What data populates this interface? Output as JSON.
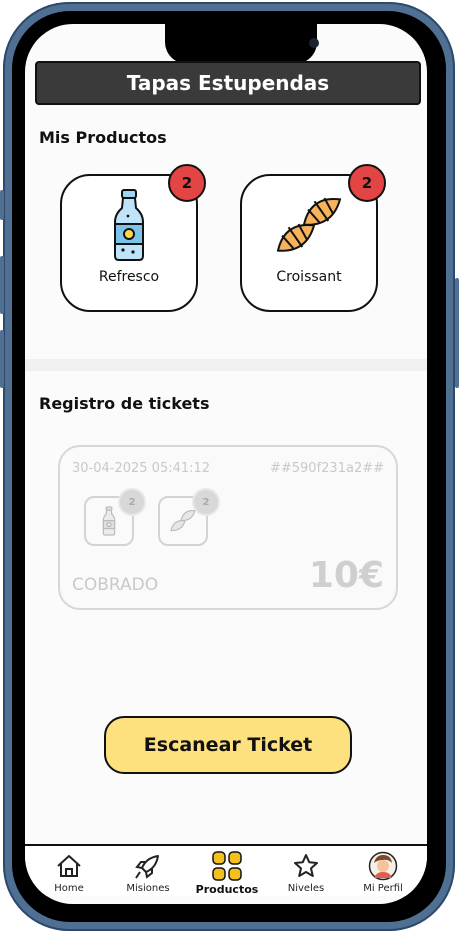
{
  "header": {
    "title": "Tapas Estupendas"
  },
  "products": {
    "title": "Mis Productos",
    "items": [
      {
        "label": "Refresco",
        "count": "2",
        "icon": "soda-bottle-icon"
      },
      {
        "label": "Croissant",
        "count": "2",
        "icon": "croissant-icon"
      }
    ]
  },
  "tickets": {
    "title": "Registro de tickets",
    "items": [
      {
        "date": "30-04-2025 05:41:12",
        "id": "##590f231a2##",
        "products": [
          {
            "icon": "soda-bottle-icon",
            "count": "2"
          },
          {
            "icon": "croissant-icon",
            "count": "2"
          }
        ],
        "status": "COBRADO",
        "amount": "10€"
      }
    ]
  },
  "scan_button": {
    "label": "Escanear Ticket"
  },
  "tabbar": {
    "items": [
      {
        "label": "Home",
        "icon": "home-icon"
      },
      {
        "label": "Misiones",
        "icon": "rocket-icon"
      },
      {
        "label": "Productos",
        "icon": "grid-icon",
        "active": true
      },
      {
        "label": "Niveles",
        "icon": "star-icon"
      },
      {
        "label": "Mi Perfil",
        "icon": "avatar-icon"
      }
    ]
  },
  "colors": {
    "accent_button": "#fde17e",
    "badge": "#e34444",
    "header_bg": "#3a3a3a",
    "active_tab_icon": "#f2c21a"
  }
}
